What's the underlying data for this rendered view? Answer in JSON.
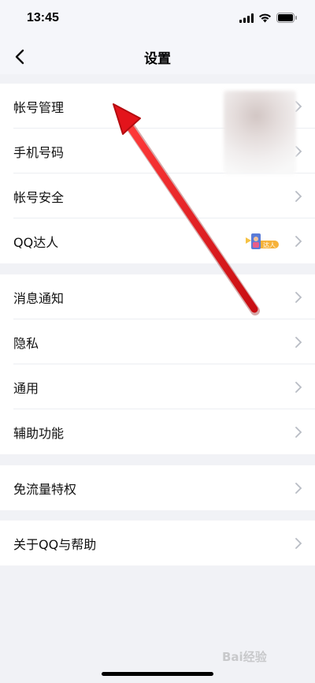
{
  "status_bar": {
    "time": "13:45"
  },
  "header": {
    "title": "设置"
  },
  "groups": [
    {
      "items": [
        {
          "label": "帐号管理"
        },
        {
          "label": "手机号码"
        },
        {
          "label": "帐号安全"
        },
        {
          "label": "QQ达人",
          "badge_text": "达人"
        }
      ]
    },
    {
      "items": [
        {
          "label": "消息通知"
        },
        {
          "label": "隐私"
        },
        {
          "label": "通用"
        },
        {
          "label": "辅助功能"
        }
      ]
    },
    {
      "items": [
        {
          "label": "免流量特权"
        }
      ]
    },
    {
      "items": [
        {
          "label": "关于QQ与帮助"
        }
      ]
    }
  ],
  "watermark": "Bai经验",
  "colors": {
    "background": "#f1f2f6",
    "row_bg": "#ffffff",
    "chevron": "#b8bcc4",
    "arrow": "#e3141b"
  }
}
